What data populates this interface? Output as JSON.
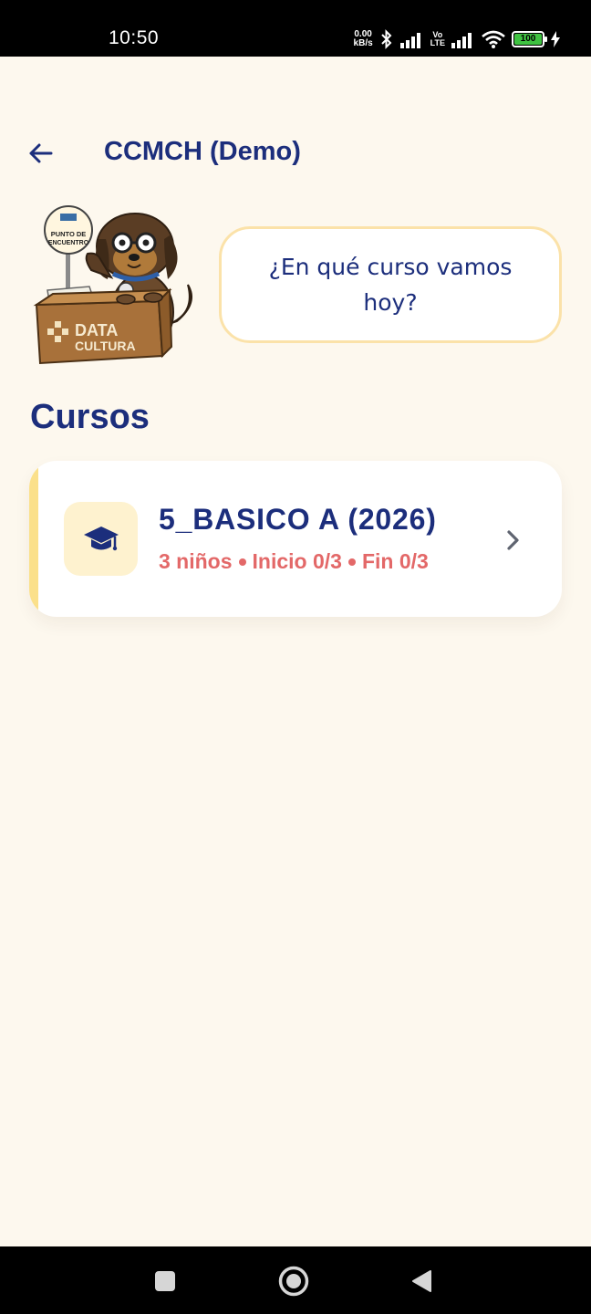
{
  "status_bar": {
    "time": "10:50",
    "speed_value": "0.00",
    "speed_unit": "kB/s",
    "battery": "100",
    "volte_top": "Vo",
    "volte_bottom": "LTE"
  },
  "header": {
    "title": "CCMCH (Demo)",
    "back_icon": "arrow-left-icon"
  },
  "mascot": {
    "sign_text_1": "PUNTO DE",
    "sign_text_2": "ENCUENTRO",
    "logo_line_1": "DATA",
    "logo_line_2": "CULTURA"
  },
  "bubble": {
    "text": "¿En qué curso vamos hoy?"
  },
  "section": {
    "title": "Cursos"
  },
  "courses": [
    {
      "name": "5_BASICO A (2026)",
      "kids": "3 niños",
      "inicio": "Inicio 0/3",
      "fin": "Fin 0/3",
      "icon": "graduation-cap-icon"
    }
  ],
  "colors": {
    "background": "#fdf8ee",
    "primary": "#1c2e7c",
    "accent_red": "#e36868",
    "accent_yellow": "#fbe08a"
  }
}
